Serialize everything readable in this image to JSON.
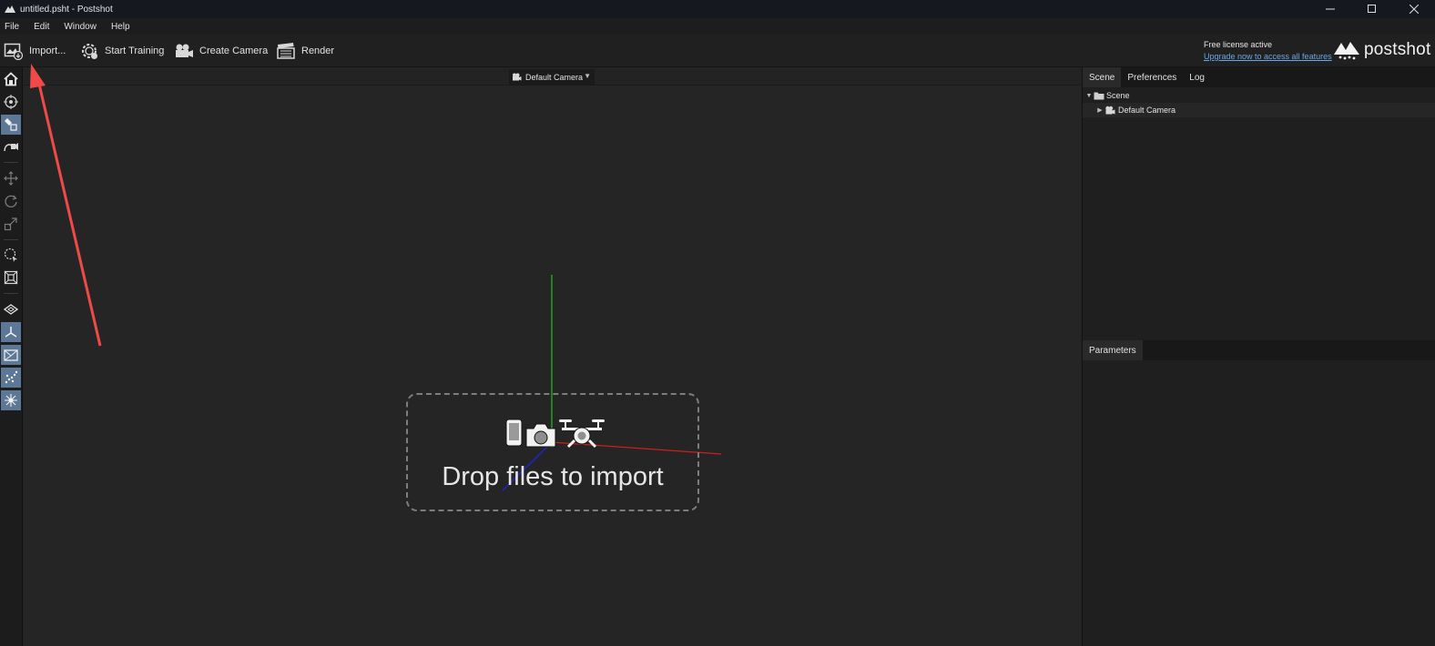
{
  "window": {
    "title": "untitled.psht - Postshot",
    "controls": [
      "minimize",
      "maximize",
      "close"
    ]
  },
  "menu": {
    "items": [
      "File",
      "Edit",
      "Window",
      "Help"
    ]
  },
  "toolbar": {
    "import_label": "Import...",
    "start_training_label": "Start Training",
    "create_camera_label": "Create Camera",
    "render_label": "Render"
  },
  "license": {
    "status": "Free license active",
    "upgrade_link": "Upgrade now to access all features"
  },
  "brand": {
    "name": "postshot"
  },
  "viewport": {
    "camera_select": "Default Camera",
    "drop_text": "Drop files to import",
    "drop_icons": [
      "phone-icon",
      "camera-icon",
      "drone-icon"
    ]
  },
  "left_tools": [
    {
      "name": "home-icon",
      "active": false
    },
    {
      "name": "orbit-icon",
      "active": false
    },
    {
      "name": "select-splat-icon",
      "active": true
    },
    {
      "name": "fly-camera-icon",
      "active": false
    },
    {
      "name": "move-icon",
      "active": false
    },
    {
      "name": "rotate-icon",
      "active": false
    },
    {
      "name": "scale-icon",
      "active": false
    },
    {
      "name": "lasso-select-icon",
      "active": false
    },
    {
      "name": "box-select-icon",
      "active": false
    },
    {
      "name": "grid-plane-icon",
      "active": false
    },
    {
      "name": "axes-icon",
      "active": true
    },
    {
      "name": "camera-frustum-icon",
      "active": true
    },
    {
      "name": "points-icon",
      "active": true
    },
    {
      "name": "splat-icon",
      "active": true
    }
  ],
  "scene_panel": {
    "tabs": [
      "Scene",
      "Preferences",
      "Log"
    ],
    "active_tab": "Scene",
    "tree": [
      {
        "label": "Scene",
        "level": 0,
        "expanded": true
      },
      {
        "label": "Default Camera",
        "level": 1,
        "expanded": false
      }
    ]
  },
  "params_panel": {
    "tabs": [
      "Parameters"
    ]
  },
  "colors": {
    "accent": "#5d7896",
    "link": "#6aa7e8",
    "axis_x": "#cc1f1f",
    "axis_y": "#22c022",
    "axis_z": "#2222cc",
    "annotation_arrow": "#f04a48"
  }
}
